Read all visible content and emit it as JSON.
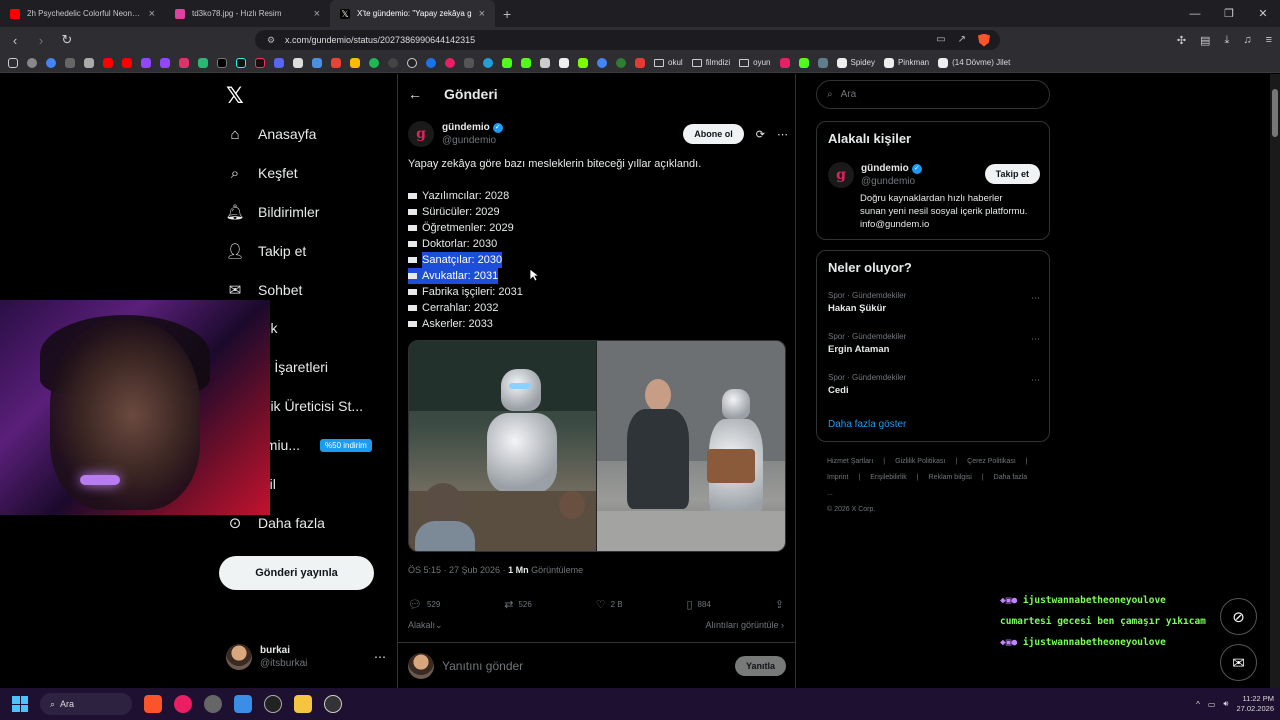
{
  "browser": {
    "tabs": [
      {
        "title": "2h Psychedelic Colorful Neon Backgr",
        "favicon_color": "#ff0000",
        "active": false
      },
      {
        "title": "td3ko78.jpg - Hızlı Resim",
        "favicon_color": "#e040a0",
        "active": false
      },
      {
        "title": "X'te gündemio: \"Yapay zekâya g",
        "favicon_color": "#ffffff",
        "active": true
      }
    ],
    "url": "x.com/gundemio/status/2027386990644142315",
    "bookmarks": [
      "okul",
      "filmdizi",
      "oyun",
      "Spidey",
      "Pinkman",
      "(14 Dövme) Jilet"
    ]
  },
  "nav": {
    "items": [
      {
        "label": "Anasayfa",
        "icon": "home-icon",
        "glyph": "⌂"
      },
      {
        "label": "Keşfet",
        "icon": "search-icon",
        "glyph": "⌕"
      },
      {
        "label": "Bildirimler",
        "icon": "bell-icon",
        "glyph": "♫"
      },
      {
        "label": "Takip et",
        "icon": "add-user-icon",
        "glyph": "⚇"
      },
      {
        "label": "Sohbet",
        "icon": "mail-icon",
        "glyph": "✉"
      },
      {
        "label": "rok",
        "icon": "grok-icon",
        "glyph": "◎"
      },
      {
        "label": "er İşaretleri",
        "icon": "bookmark-icon",
        "glyph": "▯"
      },
      {
        "label": "erik Üreticisi St...",
        "icon": "creator-icon",
        "glyph": "⚡"
      },
      {
        "label": "emiu...",
        "icon": "premium-icon",
        "glyph": "✕"
      },
      {
        "label": "ofil",
        "icon": "profile-icon",
        "glyph": "☺"
      },
      {
        "label": "Daha fazla",
        "icon": "more-circle-icon",
        "glyph": "⋯"
      }
    ],
    "promo_badge": "%50 indirim",
    "post_button": "Gönderi yayınla",
    "account": {
      "name": "burkai",
      "handle": "@itsburkai"
    }
  },
  "main": {
    "header": "Gönderi",
    "author": {
      "name": "gündemio",
      "handle": "@gundemio",
      "avatar_letter": "g"
    },
    "subscribe": "Abone ol",
    "text": "Yapay zekâya göre bazı mesleklerin biteceği yıllar açıklandı.",
    "list": [
      {
        "text": "Yazılımcılar: 2028",
        "selected": false
      },
      {
        "text": "Sürücüler: 2029",
        "selected": false
      },
      {
        "text": "Öğretmenler: 2029",
        "selected": false
      },
      {
        "text": "Doktorlar: 2030",
        "selected": false
      },
      {
        "text": "Sanatçılar: 2030",
        "selected": true
      },
      {
        "text": "Avukatlar: 2031",
        "selected": true
      },
      {
        "text": "Fabrika işçileri: 2031",
        "selected": false
      },
      {
        "text": "Cerrahlar: 2032",
        "selected": false
      },
      {
        "text": "Askerler: 2033",
        "selected": false
      }
    ],
    "meta_time": "ÖS 5:15 · 27 Şub 2026 · ",
    "meta_views_num": "1 Mn",
    "meta_views_label": " Görüntüleme",
    "actions": {
      "replies": "529",
      "reposts": "526",
      "likes": "2 B",
      "bookmarks": "884"
    },
    "sort_label": "Alakalı",
    "quotes_link": "Alıntıları görüntüle",
    "reply_placeholder": "Yanıtını gönder",
    "reply_button": "Yanıtla"
  },
  "sidebar": {
    "search_placeholder": "Ara",
    "related_title": "Alakalı kişiler",
    "person": {
      "name": "gündemio",
      "handle": "@gundemio",
      "follow": "Takip et",
      "bio": "Doğru kaynaklardan hızlı haberler sunan yeni nesil sosyal içerik platformu. info@gundem.io"
    },
    "trends_title": "Neler oluyor?",
    "trends": [
      {
        "category": "Spor · Gündemdekiler",
        "name": "Hakan Şükür"
      },
      {
        "category": "Spor · Gündemdekiler",
        "name": "Ergin Ataman"
      },
      {
        "category": "Spor · Gündemdekiler",
        "name": "Cedi"
      }
    ],
    "show_more": "Daha fazla göster",
    "footer": [
      "Hizmet Şartları",
      "|",
      "Gizlilik Politikası",
      "|",
      "Çerez Politikası",
      "|",
      "Imprint",
      "|",
      "Erişilebilirlik",
      "|",
      "Reklam bilgisi",
      "|",
      "Daha fazla ...",
      "© 2026 X Corp."
    ]
  },
  "chat": [
    {
      "emotes": "◆▣●",
      "text": "ijustwannabetheoneyoulove"
    },
    {
      "emotes": "",
      "text": "cumartesi gecesi ben çamaşır yıkıcam"
    },
    {
      "emotes": "◆▣●",
      "text": "ijustwannabetheoneyoulove"
    }
  ],
  "taskbar": {
    "search": "Ara",
    "time": "11:22 PM",
    "date": "27.02.2026"
  }
}
